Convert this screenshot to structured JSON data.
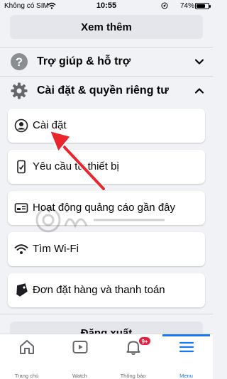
{
  "status_bar": {
    "carrier": "Không có SIM",
    "time": "10:55",
    "battery_percent": "74%",
    "battery_level": 0.74
  },
  "see_more_label": "Xem thêm",
  "help_section": {
    "label": "Trợ giúp & hỗ trợ",
    "icon": "question-icon"
  },
  "settings_section": {
    "label": "Cài đặt & quyền riêng tư",
    "icon": "gear-icon",
    "expanded": true
  },
  "settings_items": [
    {
      "label": "Cài đặt",
      "icon": "user-circle-icon"
    },
    {
      "label": "Yêu cầu từ thiết bị",
      "icon": "phone-icon"
    },
    {
      "label": "Hoạt động quảng cáo gần đây",
      "icon": "ad-icon"
    },
    {
      "label": "Tìm Wi-Fi",
      "icon": "wifi-icon"
    },
    {
      "label": "Đơn đặt hàng và thanh toán",
      "icon": "tag-icon"
    }
  ],
  "logout_label": "Đăng xuất",
  "tabs": [
    {
      "label": "Trang chủ",
      "icon": "home-icon"
    },
    {
      "label": "Watch",
      "icon": "watch-icon"
    },
    {
      "label": "Thông báo",
      "icon": "bell-icon",
      "badge": "9+"
    },
    {
      "label": "Menu",
      "icon": "menu-icon",
      "active": true
    }
  ],
  "colors": {
    "accent": "#1877f2",
    "badge": "#e41e3f",
    "annotation_arrow": "#e8262b",
    "background": "#f0f2f5"
  }
}
